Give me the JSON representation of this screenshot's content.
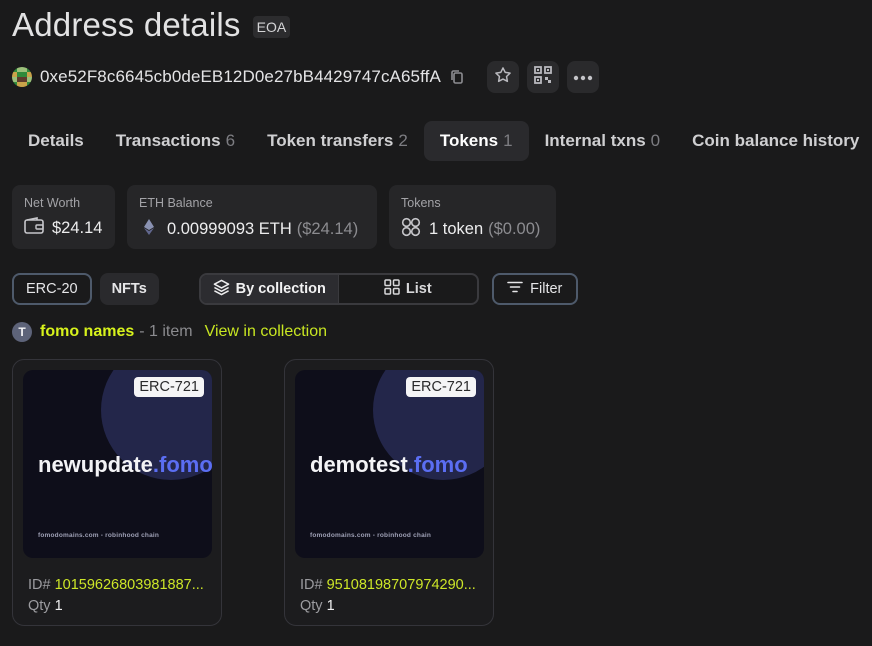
{
  "page": {
    "title": "Address details",
    "badge": "EOA"
  },
  "address": {
    "value": "0xe52F8c6645cb0deEB12D0e27bB4429747cA65ffA",
    "avatar_colors": [
      "#2f8a3b",
      "#c9a34a",
      "#9cc07a",
      "#5d3b2c"
    ],
    "icons": [
      "copy-icon",
      "star-icon",
      "qr-code-icon",
      "more-icon"
    ]
  },
  "tabs": [
    {
      "label": "Details",
      "count": ""
    },
    {
      "label": "Transactions",
      "count": "6"
    },
    {
      "label": "Token transfers",
      "count": "2"
    },
    {
      "label": "Tokens",
      "count": "1",
      "active": true
    },
    {
      "label": "Internal txns",
      "count": "0"
    },
    {
      "label": "Coin balance history",
      "count": ""
    }
  ],
  "stats": {
    "net_worth": {
      "label": "Net Worth",
      "value": "$24.14"
    },
    "eth_balance": {
      "label": "ETH Balance",
      "value": "0.00999093 ETH",
      "usd": "($24.14)"
    },
    "tokens": {
      "label": "Tokens",
      "value": "1 token",
      "usd": "($0.00)"
    }
  },
  "filters": {
    "erc20": "ERC-20",
    "nfts": "NFTs",
    "by_collection": "By collection",
    "list": "List",
    "filter": "Filter"
  },
  "collection": {
    "avatar_letter": "T",
    "name": "fomo names",
    "count_text": "- 1 item",
    "link": "View in collection"
  },
  "cards": [
    {
      "type": "ERC-721",
      "domain_name": "newupdate",
      "domain_tld": ".fomo",
      "footer": "fomodomains.com - robinhood chain",
      "id_label": "ID#",
      "id": "10159626803981887...",
      "qty_label": "Qty",
      "qty": "1"
    },
    {
      "type": "ERC-721",
      "domain_name": "demotest",
      "domain_tld": ".fomo",
      "footer": "fomodomains.com - robinhood chain",
      "id_label": "ID#",
      "id": "95108198707974290...",
      "qty_label": "Qty",
      "qty": "1"
    }
  ],
  "colors": {
    "background": "#1a1a1b",
    "accent_green": "#d7f21c",
    "tld_blue": "#5b6ef2"
  }
}
